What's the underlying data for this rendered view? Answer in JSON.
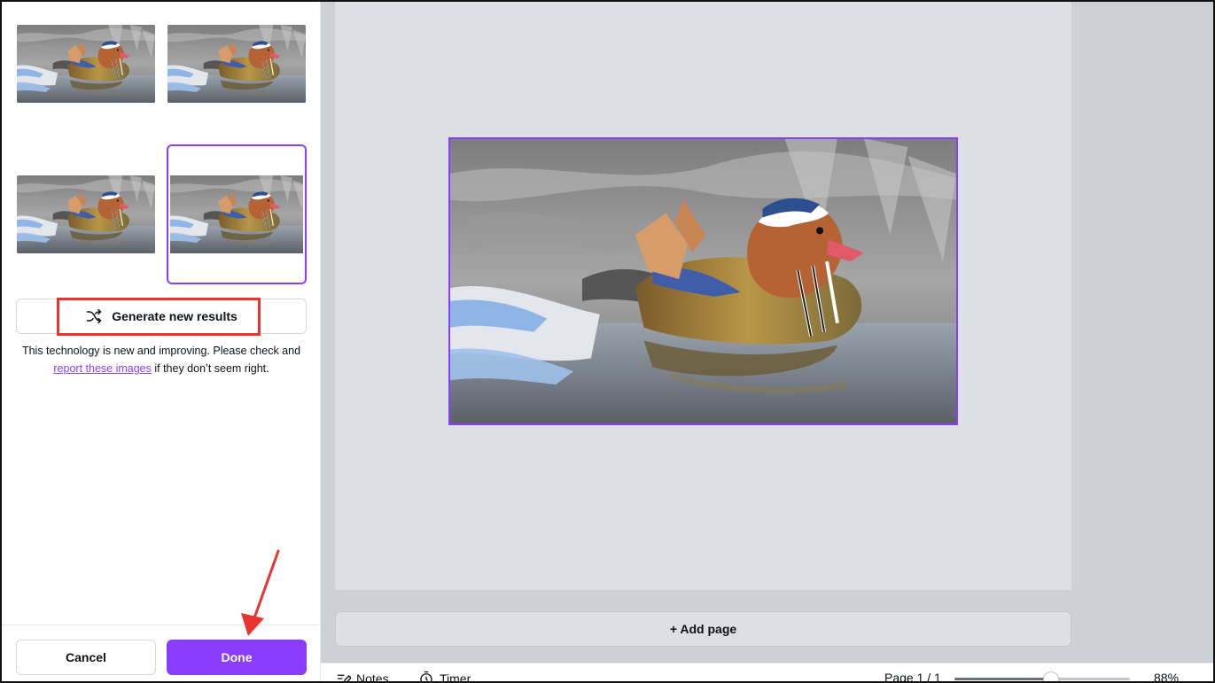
{
  "panel": {
    "thumbnails": [
      {
        "name": "result-1",
        "selected": false
      },
      {
        "name": "result-2",
        "selected": false
      },
      {
        "name": "result-3",
        "selected": false
      },
      {
        "name": "result-4",
        "selected": true
      }
    ],
    "generate_button": {
      "label": "Generate new results",
      "icon": "shuffle-icon"
    },
    "disclaimer": {
      "before": "This technology is new and improving. Please check and",
      "link": "report these images",
      "after": "if they don’t seem right."
    },
    "cancel_label": "Cancel",
    "done_label": "Done"
  },
  "canvas": {
    "add_page_label": "+ Add page"
  },
  "bottombar": {
    "notes_label": "Notes",
    "timer_label": "Timer",
    "page_indicator": "Page 1 / 1",
    "zoom_label": "88%",
    "zoom_value": 0.55
  },
  "colors": {
    "accent": "#8b3dff",
    "annotation_red": "#e8352f"
  }
}
